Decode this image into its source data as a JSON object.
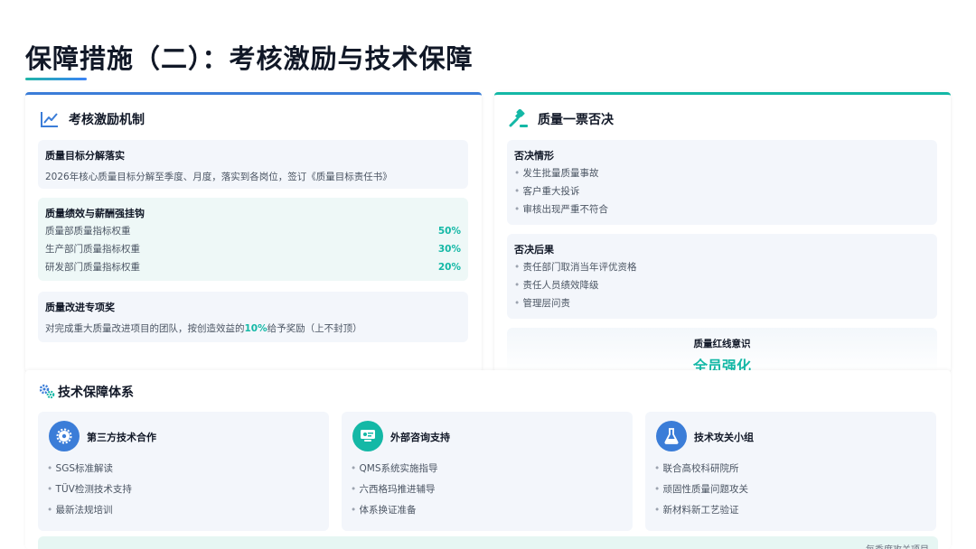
{
  "title": "保障措施（二）：考核激励与技术保障",
  "left_card": {
    "heading": "考核激励机制",
    "goal": {
      "title": "质量目标分解落实",
      "text": "2026年核心质量目标分解至季度、月度，落实到各岗位，签订《质量目标责任书》"
    },
    "performance": {
      "title": "质量绩效与薪酬强挂钩",
      "rows": [
        {
          "label": "质量部质量指标权重",
          "value": "50%"
        },
        {
          "label": "生产部门质量指标权重",
          "value": "30%"
        },
        {
          "label": "研发部门质量指标权重",
          "value": "20%"
        }
      ]
    },
    "award": {
      "title": "质量改进专项奖",
      "text_before": "对完成重大质量改进项目的团队，按创造效益的",
      "highlight": "10%",
      "text_after": "给予奖励（上不封顶）"
    }
  },
  "right_card": {
    "heading": "质量一票否决",
    "situations": {
      "title": "否决情形",
      "items": [
        "发生批量质量事故",
        "客户重大投诉",
        "审核出现严重不符合"
      ]
    },
    "consequences": {
      "title": "否决后果",
      "items": [
        "责任部门取消当年评优资格",
        "责任人员绩效降级",
        "管理层问责"
      ]
    },
    "redline": {
      "label": "质量红线意识",
      "value": "全员强化"
    }
  },
  "tech": {
    "heading": "技术保障体系",
    "cards": [
      {
        "title": "第三方技术合作",
        "icon": "gear-icon",
        "color": "#3b7dd8",
        "items": [
          "SGS标准解读",
          "TÜV检测技术支持",
          "最新法规培训"
        ]
      },
      {
        "title": "外部咨询支持",
        "icon": "consultant-icon",
        "color": "#14b8a6",
        "items": [
          "QMS系统实施指导",
          "六西格玛推进辅导",
          "体系换证准备"
        ]
      },
      {
        "title": "技术攻关小组",
        "icon": "flask-icon",
        "color": "#3b7dd8",
        "items": [
          "联合高校科研院所",
          "顽固性质量问题攻关",
          "新材料新工艺验证"
        ]
      }
    ]
  },
  "bottom_note": "每季度攻关项目"
}
